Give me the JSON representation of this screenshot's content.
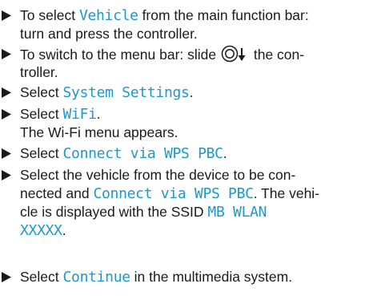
{
  "colors": {
    "text": "#1a1a1a",
    "highlight": "#1f97cc"
  },
  "steps": [
    {
      "l1_a": "To select ",
      "l1_hl": "Vehicle",
      "l1_b": " from the main function bar:",
      "l2": "turn and press the controller."
    },
    {
      "l1_a": "To switch to the menu bar: slide ",
      "l1_b": " the con-",
      "l2": "troller."
    },
    {
      "l1_a": "Select ",
      "l1_hl": "System Settings",
      "l1_b": "."
    },
    {
      "l1_a": "Select ",
      "l1_hl": "WiFi",
      "l1_b": ".",
      "l2": "The Wi-Fi menu appears."
    },
    {
      "l1_a": "Select ",
      "l1_hl": "Connect via WPS PBC",
      "l1_b": "."
    },
    {
      "l1": "Select the vehicle from the device to be con-",
      "l2_a": "nected and ",
      "l2_hl": "Connect via WPS PBC",
      "l2_b": ". The vehi-",
      "l3_a": "cle is displayed with the SSID ",
      "l3_hl": "MB WLAN",
      "l4_hl": "XXXXX",
      "l4_b": "."
    },
    {
      "l1_a": "Select ",
      "l1_hl": "Continue",
      "l1_b": " in the multimedia system."
    }
  ]
}
